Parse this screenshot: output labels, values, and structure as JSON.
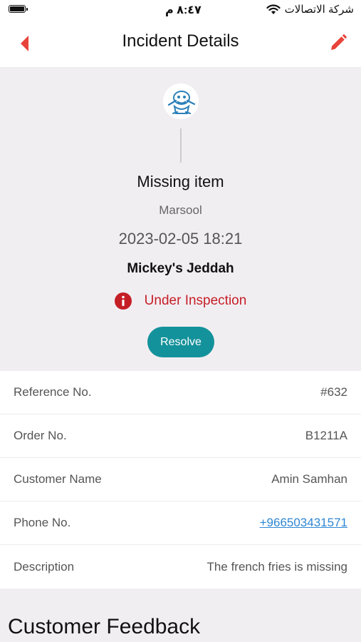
{
  "status_bar": {
    "time": "٨:٤٧ م",
    "carrier": "شركة الاتصالات"
  },
  "header": {
    "title": "Incident Details",
    "back_icon": "chevron-left-icon",
    "edit_icon": "pencil-icon"
  },
  "incident": {
    "type": "Missing item",
    "company": "Marsool",
    "datetime": "2023-02-05 18:21",
    "branch": "Mickey's Jeddah",
    "status": "Under Inspection",
    "resolve_label": "Resolve"
  },
  "details": [
    {
      "label": "Reference No.",
      "value": "#632"
    },
    {
      "label": "Order No.",
      "value": "B1211A"
    },
    {
      "label": "Customer Name",
      "value": "Amin Samhan"
    },
    {
      "label": "Phone No.",
      "value": "+966503431571"
    },
    {
      "label": "Description",
      "value": "The french fries is missing"
    }
  ],
  "feedback": {
    "heading": "Customer Feedback"
  },
  "colors": {
    "accent_red": "#e8433a",
    "status_red": "#c51f26",
    "teal": "#14929b",
    "link_blue": "#2f86d3"
  }
}
